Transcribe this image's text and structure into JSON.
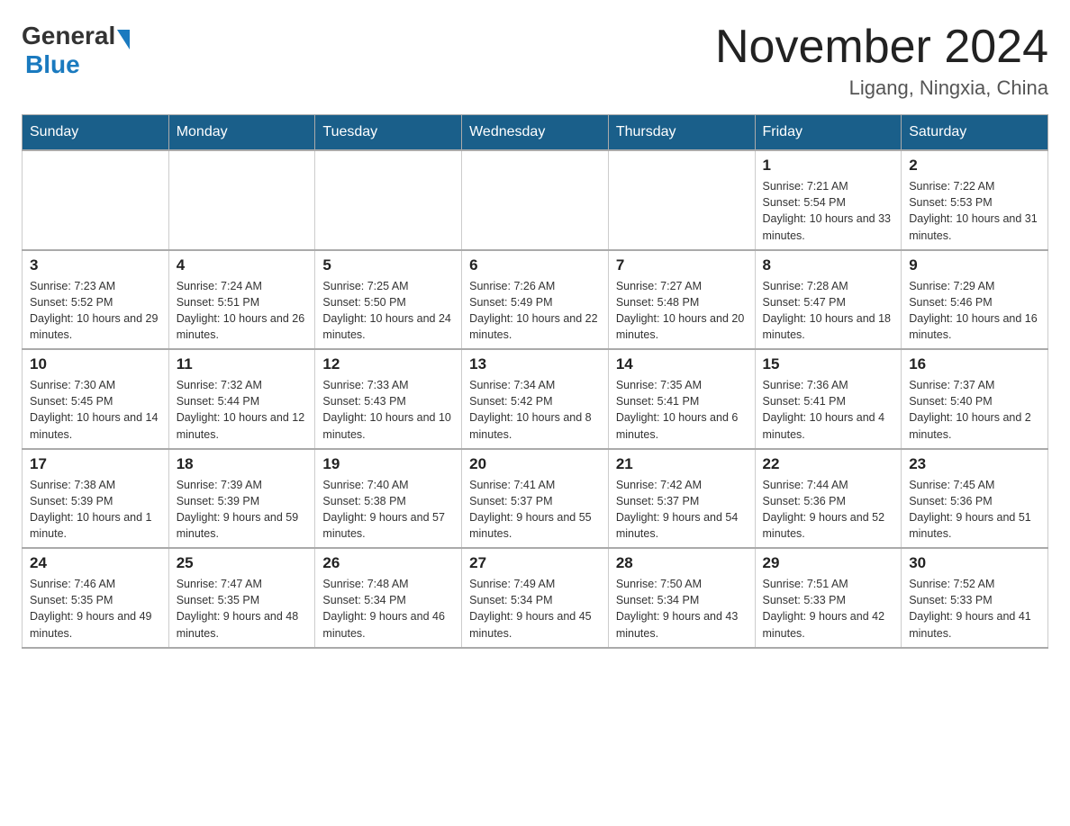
{
  "header": {
    "logo_general": "General",
    "logo_blue": "Blue",
    "month_title": "November 2024",
    "location": "Ligang, Ningxia, China"
  },
  "weekdays": [
    "Sunday",
    "Monday",
    "Tuesday",
    "Wednesday",
    "Thursday",
    "Friday",
    "Saturday"
  ],
  "weeks": [
    [
      {
        "day": "",
        "info": ""
      },
      {
        "day": "",
        "info": ""
      },
      {
        "day": "",
        "info": ""
      },
      {
        "day": "",
        "info": ""
      },
      {
        "day": "",
        "info": ""
      },
      {
        "day": "1",
        "info": "Sunrise: 7:21 AM\nSunset: 5:54 PM\nDaylight: 10 hours and 33 minutes."
      },
      {
        "day": "2",
        "info": "Sunrise: 7:22 AM\nSunset: 5:53 PM\nDaylight: 10 hours and 31 minutes."
      }
    ],
    [
      {
        "day": "3",
        "info": "Sunrise: 7:23 AM\nSunset: 5:52 PM\nDaylight: 10 hours and 29 minutes."
      },
      {
        "day": "4",
        "info": "Sunrise: 7:24 AM\nSunset: 5:51 PM\nDaylight: 10 hours and 26 minutes."
      },
      {
        "day": "5",
        "info": "Sunrise: 7:25 AM\nSunset: 5:50 PM\nDaylight: 10 hours and 24 minutes."
      },
      {
        "day": "6",
        "info": "Sunrise: 7:26 AM\nSunset: 5:49 PM\nDaylight: 10 hours and 22 minutes."
      },
      {
        "day": "7",
        "info": "Sunrise: 7:27 AM\nSunset: 5:48 PM\nDaylight: 10 hours and 20 minutes."
      },
      {
        "day": "8",
        "info": "Sunrise: 7:28 AM\nSunset: 5:47 PM\nDaylight: 10 hours and 18 minutes."
      },
      {
        "day": "9",
        "info": "Sunrise: 7:29 AM\nSunset: 5:46 PM\nDaylight: 10 hours and 16 minutes."
      }
    ],
    [
      {
        "day": "10",
        "info": "Sunrise: 7:30 AM\nSunset: 5:45 PM\nDaylight: 10 hours and 14 minutes."
      },
      {
        "day": "11",
        "info": "Sunrise: 7:32 AM\nSunset: 5:44 PM\nDaylight: 10 hours and 12 minutes."
      },
      {
        "day": "12",
        "info": "Sunrise: 7:33 AM\nSunset: 5:43 PM\nDaylight: 10 hours and 10 minutes."
      },
      {
        "day": "13",
        "info": "Sunrise: 7:34 AM\nSunset: 5:42 PM\nDaylight: 10 hours and 8 minutes."
      },
      {
        "day": "14",
        "info": "Sunrise: 7:35 AM\nSunset: 5:41 PM\nDaylight: 10 hours and 6 minutes."
      },
      {
        "day": "15",
        "info": "Sunrise: 7:36 AM\nSunset: 5:41 PM\nDaylight: 10 hours and 4 minutes."
      },
      {
        "day": "16",
        "info": "Sunrise: 7:37 AM\nSunset: 5:40 PM\nDaylight: 10 hours and 2 minutes."
      }
    ],
    [
      {
        "day": "17",
        "info": "Sunrise: 7:38 AM\nSunset: 5:39 PM\nDaylight: 10 hours and 1 minute."
      },
      {
        "day": "18",
        "info": "Sunrise: 7:39 AM\nSunset: 5:39 PM\nDaylight: 9 hours and 59 minutes."
      },
      {
        "day": "19",
        "info": "Sunrise: 7:40 AM\nSunset: 5:38 PM\nDaylight: 9 hours and 57 minutes."
      },
      {
        "day": "20",
        "info": "Sunrise: 7:41 AM\nSunset: 5:37 PM\nDaylight: 9 hours and 55 minutes."
      },
      {
        "day": "21",
        "info": "Sunrise: 7:42 AM\nSunset: 5:37 PM\nDaylight: 9 hours and 54 minutes."
      },
      {
        "day": "22",
        "info": "Sunrise: 7:44 AM\nSunset: 5:36 PM\nDaylight: 9 hours and 52 minutes."
      },
      {
        "day": "23",
        "info": "Sunrise: 7:45 AM\nSunset: 5:36 PM\nDaylight: 9 hours and 51 minutes."
      }
    ],
    [
      {
        "day": "24",
        "info": "Sunrise: 7:46 AM\nSunset: 5:35 PM\nDaylight: 9 hours and 49 minutes."
      },
      {
        "day": "25",
        "info": "Sunrise: 7:47 AM\nSunset: 5:35 PM\nDaylight: 9 hours and 48 minutes."
      },
      {
        "day": "26",
        "info": "Sunrise: 7:48 AM\nSunset: 5:34 PM\nDaylight: 9 hours and 46 minutes."
      },
      {
        "day": "27",
        "info": "Sunrise: 7:49 AM\nSunset: 5:34 PM\nDaylight: 9 hours and 45 minutes."
      },
      {
        "day": "28",
        "info": "Sunrise: 7:50 AM\nSunset: 5:34 PM\nDaylight: 9 hours and 43 minutes."
      },
      {
        "day": "29",
        "info": "Sunrise: 7:51 AM\nSunset: 5:33 PM\nDaylight: 9 hours and 42 minutes."
      },
      {
        "day": "30",
        "info": "Sunrise: 7:52 AM\nSunset: 5:33 PM\nDaylight: 9 hours and 41 minutes."
      }
    ]
  ]
}
